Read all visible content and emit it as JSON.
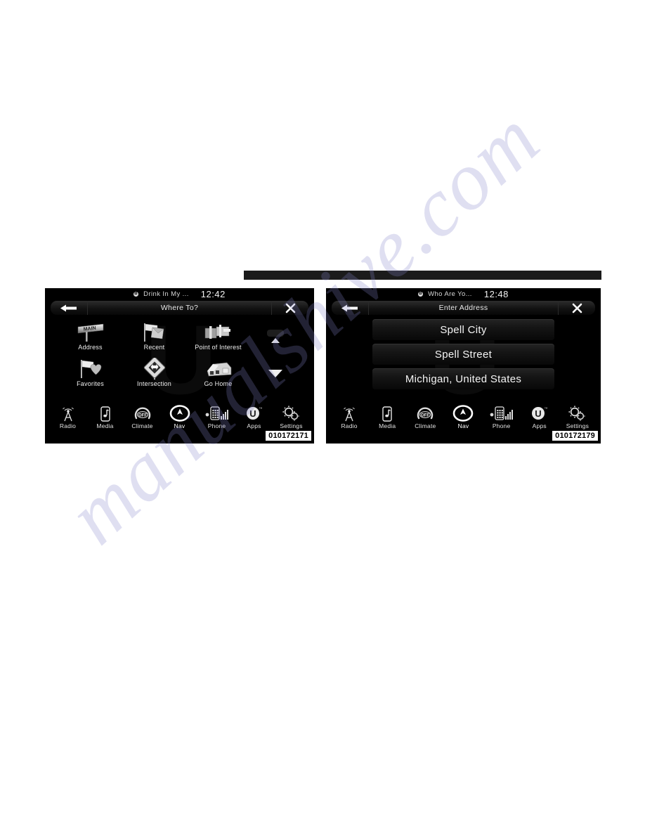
{
  "page": {
    "background_color": "#ffffff",
    "watermark_text": "manualshive.com",
    "rule_color": "#1b1b1b"
  },
  "screens": [
    {
      "id": "where-to",
      "caption": "010172171",
      "status": {
        "bluetooth_icon": "bluetooth-icon",
        "source_text": "Drink In My ...",
        "clock": "12:42"
      },
      "title_bar": {
        "back_icon": "arrow-left-icon",
        "title": "Where To?",
        "close_icon": "close-x-icon"
      },
      "tiles": [
        {
          "label": "Address",
          "icon": "street-sign-icon"
        },
        {
          "label": "Recent",
          "icon": "flag-recent-icon"
        },
        {
          "label": "Point of Interest",
          "icon": "point-of-interest-icon"
        },
        {
          "label": "Favorites",
          "icon": "flag-heart-icon"
        },
        {
          "label": "Intersection",
          "icon": "intersection-icon"
        },
        {
          "label": "Go Home",
          "icon": "home-icon"
        }
      ],
      "scroll": {
        "up_icon": "scroll-up-icon",
        "down_icon": "scroll-down-icon"
      },
      "nav": [
        {
          "label": "Radio",
          "icon": "radio-tower-icon",
          "active": false
        },
        {
          "label": "Media",
          "icon": "media-note-icon",
          "active": false
        },
        {
          "label": "Climate",
          "icon": "climate-off-icon",
          "active": false
        },
        {
          "label": "Nav",
          "icon": "nav-compass-icon",
          "active": true
        },
        {
          "label": "Phone",
          "icon": "phone-icon",
          "active": false
        },
        {
          "label": "Apps",
          "icon": "apps-uconnect-icon",
          "active": false
        },
        {
          "label": "Settings",
          "icon": "settings-gear-icon",
          "active": false
        }
      ]
    },
    {
      "id": "enter-address",
      "caption": "010172179",
      "status": {
        "bluetooth_icon": "bluetooth-icon",
        "source_text": "Who Are Yo...",
        "clock": "12:48"
      },
      "title_bar": {
        "back_icon": "arrow-left-icon",
        "title": "Enter Address",
        "close_icon": "close-x-icon"
      },
      "list": [
        {
          "label": "Spell City"
        },
        {
          "label": "Spell Street"
        },
        {
          "label": "Michigan, United States"
        }
      ],
      "nav": [
        {
          "label": "Radio",
          "icon": "radio-tower-icon",
          "active": false
        },
        {
          "label": "Media",
          "icon": "media-note-icon",
          "active": false
        },
        {
          "label": "Climate",
          "icon": "climate-off-icon",
          "active": false
        },
        {
          "label": "Nav",
          "icon": "nav-compass-icon",
          "active": true
        },
        {
          "label": "Phone",
          "icon": "phone-icon",
          "active": false
        },
        {
          "label": "Apps",
          "icon": "apps-uconnect-icon",
          "active": false
        },
        {
          "label": "Settings",
          "icon": "settings-gear-icon",
          "active": false
        }
      ]
    }
  ]
}
